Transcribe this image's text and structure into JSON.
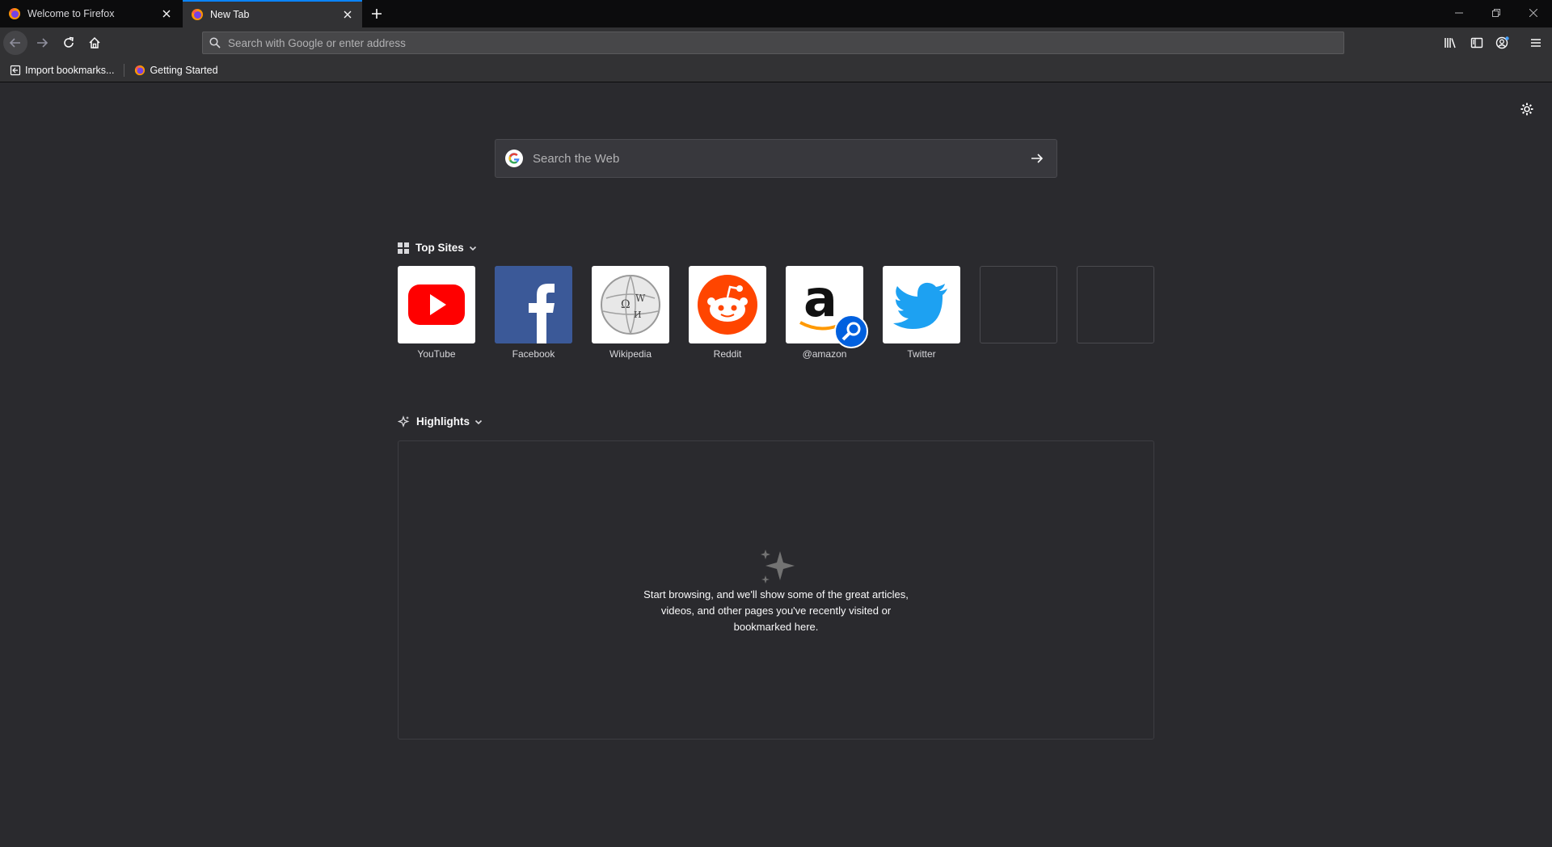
{
  "tabs": [
    {
      "title": "Welcome to Firefox",
      "active": false
    },
    {
      "title": "New Tab",
      "active": true
    }
  ],
  "urlbar": {
    "placeholder": "Search with Google or enter address",
    "value": ""
  },
  "bookmarks": [
    {
      "label": "Import bookmarks..."
    },
    {
      "label": "Getting Started"
    }
  ],
  "search": {
    "placeholder": "Search the Web"
  },
  "top_sites": {
    "label": "Top Sites",
    "sites": [
      {
        "name": "YouTube",
        "icon": "youtube-logo"
      },
      {
        "name": "Facebook",
        "icon": "facebook-logo"
      },
      {
        "name": "Wikipedia",
        "icon": "wikipedia-logo"
      },
      {
        "name": "Reddit",
        "icon": "reddit-logo"
      },
      {
        "name": "@amazon",
        "icon": "amazon-logo"
      },
      {
        "name": "Twitter",
        "icon": "twitter-logo"
      }
    ]
  },
  "highlights": {
    "label": "Highlights",
    "empty_message": [
      "Start browsing, and we'll show some of the great articles,",
      "videos, and other pages you've recently visited or",
      "bookmarked here."
    ]
  },
  "colors": {
    "accent": "#0a84ff",
    "background": "#2a2a2e",
    "toolbar": "#323234",
    "tabstrip": "#0c0c0d"
  }
}
